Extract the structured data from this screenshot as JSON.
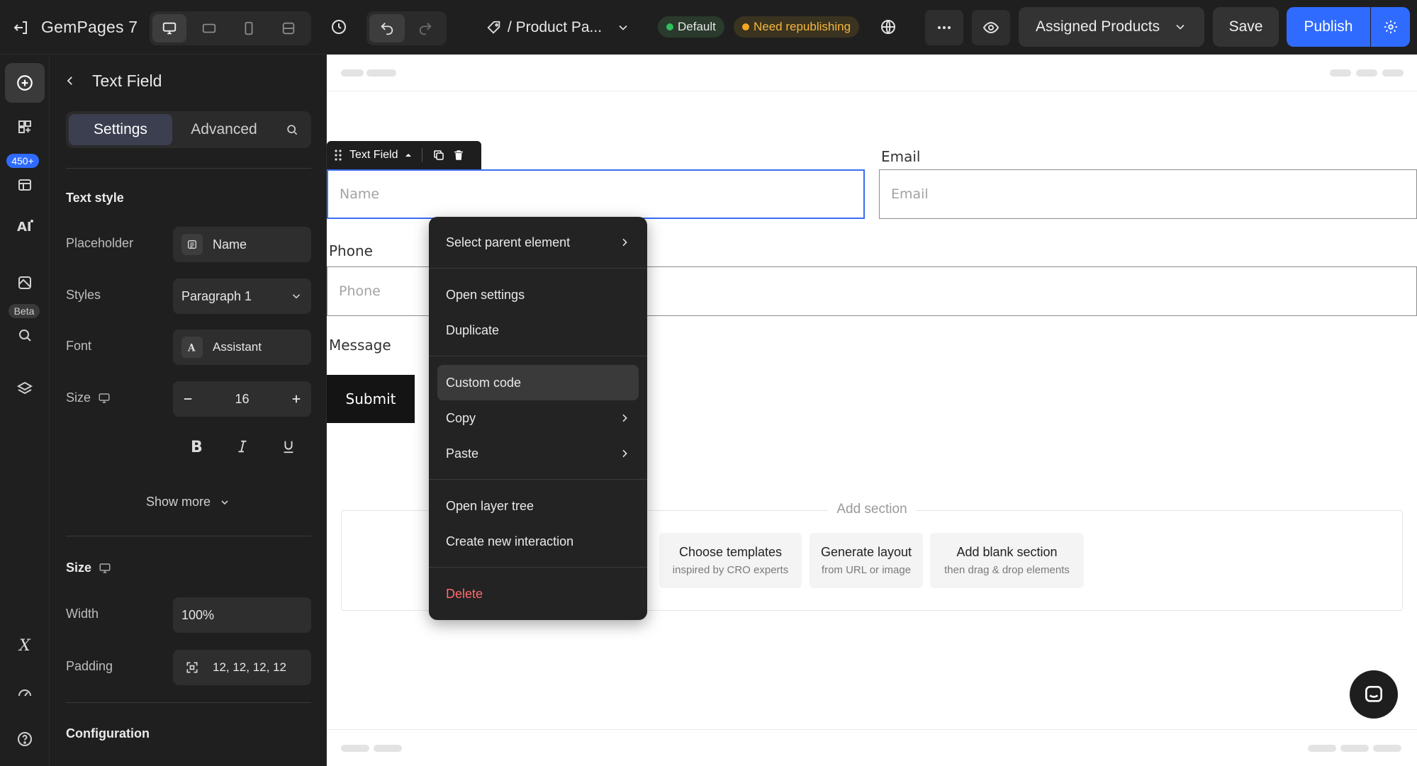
{
  "app": {
    "brand": "GemPages 7",
    "page_name": "/ Product Pa...",
    "badge_default": "Default",
    "badge_republish": "Need republishing",
    "assigned_products": "Assigned Products",
    "save": "Save",
    "publish": "Publish",
    "colors": {
      "accent": "#2f6bff",
      "default_dot": "#2fbf5a",
      "republish_dot": "#f5a623",
      "republish_text": "#f5b63d",
      "danger": "#ff6b6b",
      "selection": "#3b6df2"
    }
  },
  "rail": {
    "badge_count": "450+",
    "beta": "Beta"
  },
  "panel": {
    "back_title": "Text Field",
    "tabs": [
      "Settings",
      "Advanced"
    ],
    "text_style": {
      "title": "Text style",
      "placeholder_label": "Placeholder",
      "placeholder_value": "Name",
      "styles_label": "Styles",
      "styles_value": "Paragraph 1",
      "font_label": "Font",
      "font_value": "Assistant",
      "size_label": "Size",
      "size_value": "16",
      "show_more": "Show more"
    },
    "size_section": {
      "title": "Size",
      "width_label": "Width",
      "width_value": "100%",
      "padding_label": "Padding",
      "padding_value": "12, 12, 12, 12"
    },
    "configuration": {
      "title": "Configuration"
    }
  },
  "canvas": {
    "toolbar_label": "Text Field",
    "name_placeholder": "Name",
    "email_label": "Email",
    "email_placeholder": "Email",
    "phone_label": "Phone",
    "phone_placeholder": "Phone",
    "message_label": "Message",
    "submit": "Submit",
    "add_section": "Add section",
    "choices": [
      {
        "title": "Choose templates",
        "sub": "inspired by CRO experts"
      },
      {
        "title": "Generate layout",
        "sub": "from URL or image"
      },
      {
        "title": "Add blank section",
        "sub": "then drag & drop elements"
      }
    ]
  },
  "context_menu": {
    "select_parent": "Select parent element",
    "open_settings": "Open settings",
    "duplicate": "Duplicate",
    "custom_code": "Custom code",
    "copy": "Copy",
    "paste": "Paste",
    "open_layer_tree": "Open layer tree",
    "create_interaction": "Create new interaction",
    "delete": "Delete"
  }
}
